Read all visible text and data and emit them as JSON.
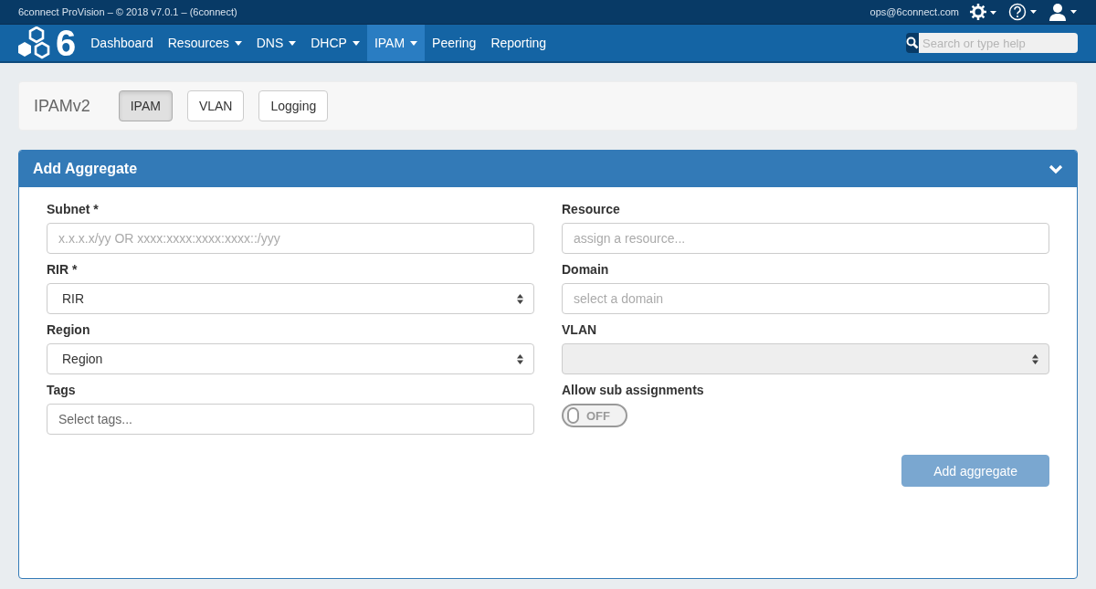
{
  "top_bar": {
    "title": "6connect ProVision – © 2018 v7.0.1 – (6connect)",
    "user_email": "ops@6connect.com"
  },
  "nav": {
    "logo_text": "6",
    "items": [
      {
        "label": "Dashboard",
        "dropdown": false,
        "selected": false
      },
      {
        "label": "Resources",
        "dropdown": true,
        "selected": false
      },
      {
        "label": "DNS",
        "dropdown": true,
        "selected": false
      },
      {
        "label": "DHCP",
        "dropdown": true,
        "selected": false
      },
      {
        "label": "IPAM",
        "dropdown": true,
        "selected": true
      },
      {
        "label": "Peering",
        "dropdown": false,
        "selected": false
      },
      {
        "label": "Reporting",
        "dropdown": false,
        "selected": false
      }
    ],
    "search": {
      "placeholder": "Search or type help"
    }
  },
  "subnav": {
    "title": "IPAMv2",
    "tabs": [
      {
        "label": "IPAM",
        "selected": true
      },
      {
        "label": "VLAN",
        "selected": false
      },
      {
        "label": "Logging",
        "selected": false
      }
    ]
  },
  "panel": {
    "title": "Add Aggregate",
    "expanded": true,
    "columns": [
      [
        {
          "kind": "text",
          "label": "Subnet *",
          "placeholder": "x.x.x.x/yy OR xxxx:xxxx:xxxx:xxxx::/yyy"
        },
        {
          "kind": "select",
          "label": "RIR *",
          "value": "RIR",
          "disabled": false
        },
        {
          "kind": "select",
          "label": "Region",
          "value": "Region",
          "disabled": false
        },
        {
          "kind": "text",
          "label": "Tags",
          "placeholder": "Select tags..."
        }
      ],
      [
        {
          "kind": "text",
          "label": "Resource",
          "placeholder": "assign a resource..."
        },
        {
          "kind": "text",
          "label": "Domain",
          "placeholder": "select a domain"
        },
        {
          "kind": "select",
          "label": "VLAN",
          "disabled": true
        },
        {
          "kind": "toggle",
          "label": "Allow sub assignments",
          "on": false,
          "state_text": "OFF"
        }
      ]
    ],
    "submit": {
      "label": "Add aggregate",
      "disabled": true
    }
  }
}
